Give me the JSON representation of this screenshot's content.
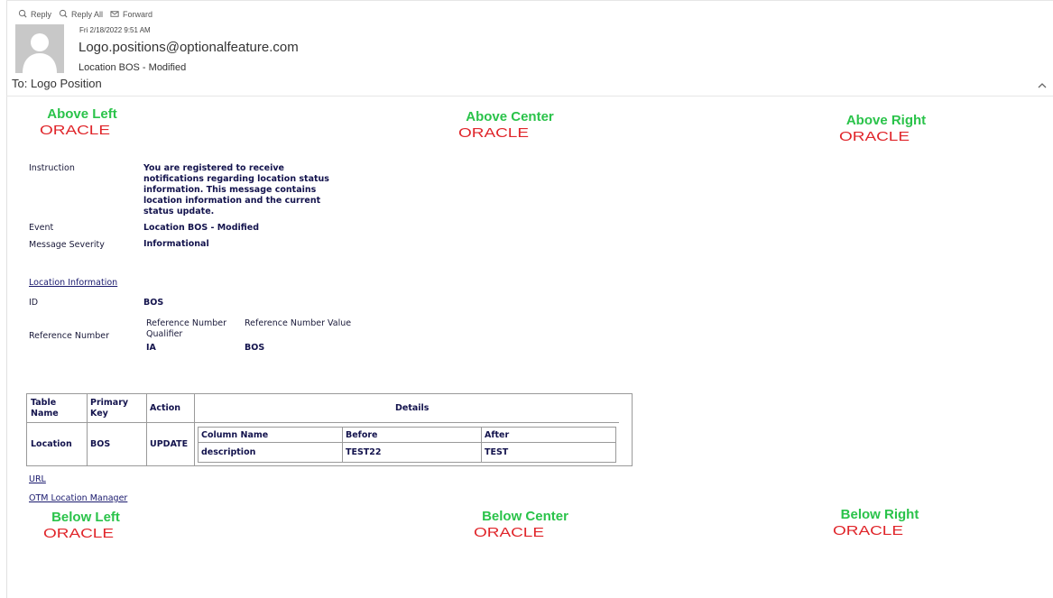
{
  "toolbar": {
    "reply": "Reply",
    "reply_all": "Reply All",
    "forward": "Forward"
  },
  "message": {
    "date": "Fri 2/18/2022 9:51 AM",
    "sender": "Logo.positions@optionalfeature.com",
    "subject": "Location BOS - Modified",
    "to": "To: Logo Position"
  },
  "logos": {
    "brand_text": "ORACLE",
    "brand_color": "#e0262b",
    "label_color": "#2ac34a",
    "above_left": "Above Left",
    "above_center": "Above Center",
    "above_right": "Above Right",
    "below_left": "Below Left",
    "below_center": "Below Center",
    "below_right": "Below Right"
  },
  "info": {
    "instruction_label": "Instruction",
    "instruction_lines": [
      "You are registered to receive",
      "notifications regarding location status",
      "information. This message contains",
      "location information and the current",
      "status update."
    ],
    "event_label": "Event",
    "event_value": "Location BOS - Modified",
    "severity_label": "Message Severity",
    "severity_value": "Informational"
  },
  "location": {
    "heading": "Location Information",
    "id_label": "ID",
    "id_value": "BOS",
    "ref_label": "Reference Number",
    "ref_qual_header_1": "Reference Number",
    "ref_qual_header_2": "Qualifier",
    "ref_value_header": "Reference Number Value",
    "ref_qual_value": "IA",
    "ref_value_value": "BOS"
  },
  "table": {
    "h_table_name_1": "Table",
    "h_table_name_2": "Name",
    "h_primary_key_1": "Primary",
    "h_primary_key_2": "Key",
    "h_action": "Action",
    "h_details": "Details",
    "table_name": "Location",
    "primary_key": "BOS",
    "action": "UPDATE",
    "d_h_column": "Column Name",
    "d_h_before": "Before",
    "d_h_after": "After",
    "d_column": "description",
    "d_before": "TEST22",
    "d_after": "TEST"
  },
  "links": {
    "url": "URL",
    "otm": "OTM Location Manager"
  }
}
